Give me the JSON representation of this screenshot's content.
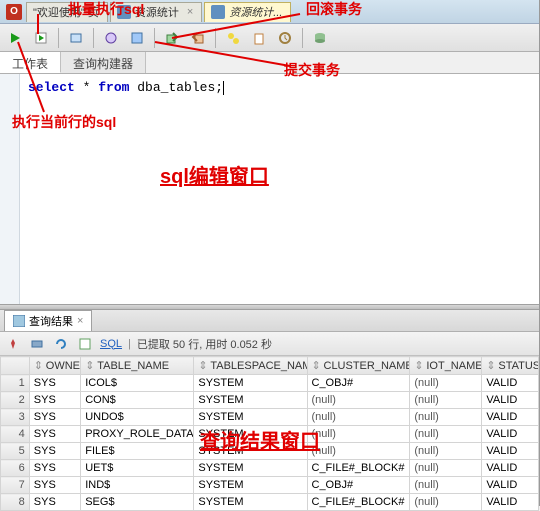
{
  "annotations": {
    "batch_sql": "批量执行sql",
    "rollback": "回滚事务",
    "commit": "提交事务",
    "run_current": "执行当前行的sql",
    "editor_label": "sql编辑窗口",
    "results_label": "查询结果窗口"
  },
  "tabs": [
    {
      "label": "\"欢迎使用\" 页"
    },
    {
      "label": "资源统计"
    },
    {
      "label": "资源统计..."
    }
  ],
  "subtabs": {
    "worksheet": "工作表",
    "querybuilder": "查询构建器"
  },
  "sql": {
    "kw1": "select",
    "mid": " * ",
    "kw2": "from",
    "rest": " dba_tables;"
  },
  "results_tab": "查询结果",
  "status": "已提取 50 行, 用时 0.052 秒",
  "sql_link": "SQL",
  "columns": [
    "",
    "OWNER",
    "TABLE_NAME",
    "TABLESPACE_NAME",
    "CLUSTER_NAME",
    "IOT_NAME",
    "STATUS"
  ],
  "chart_data": {
    "type": "table",
    "rows": [
      {
        "n": 1,
        "owner": "SYS",
        "table": "ICOL$",
        "ts": "SYSTEM",
        "cluster": "C_OBJ#",
        "iot": "(null)",
        "status": "VALID"
      },
      {
        "n": 2,
        "owner": "SYS",
        "table": "CON$",
        "ts": "SYSTEM",
        "cluster": "(null)",
        "iot": "(null)",
        "status": "VALID"
      },
      {
        "n": 3,
        "owner": "SYS",
        "table": "UNDO$",
        "ts": "SYSTEM",
        "cluster": "(null)",
        "iot": "(null)",
        "status": "VALID"
      },
      {
        "n": 4,
        "owner": "SYS",
        "table": "PROXY_ROLE_DATA$",
        "ts": "SYSTEM",
        "cluster": "(null)",
        "iot": "(null)",
        "status": "VALID"
      },
      {
        "n": 5,
        "owner": "SYS",
        "table": "FILE$",
        "ts": "SYSTEM",
        "cluster": "(null)",
        "iot": "(null)",
        "status": "VALID"
      },
      {
        "n": 6,
        "owner": "SYS",
        "table": "UET$",
        "ts": "SYSTEM",
        "cluster": "C_FILE#_BLOCK#",
        "iot": "(null)",
        "status": "VALID"
      },
      {
        "n": 7,
        "owner": "SYS",
        "table": "IND$",
        "ts": "SYSTEM",
        "cluster": "C_OBJ#",
        "iot": "(null)",
        "status": "VALID"
      },
      {
        "n": 8,
        "owner": "SYS",
        "table": "SEG$",
        "ts": "SYSTEM",
        "cluster": "C_FILE#_BLOCK#",
        "iot": "(null)",
        "status": "VALID"
      }
    ]
  }
}
